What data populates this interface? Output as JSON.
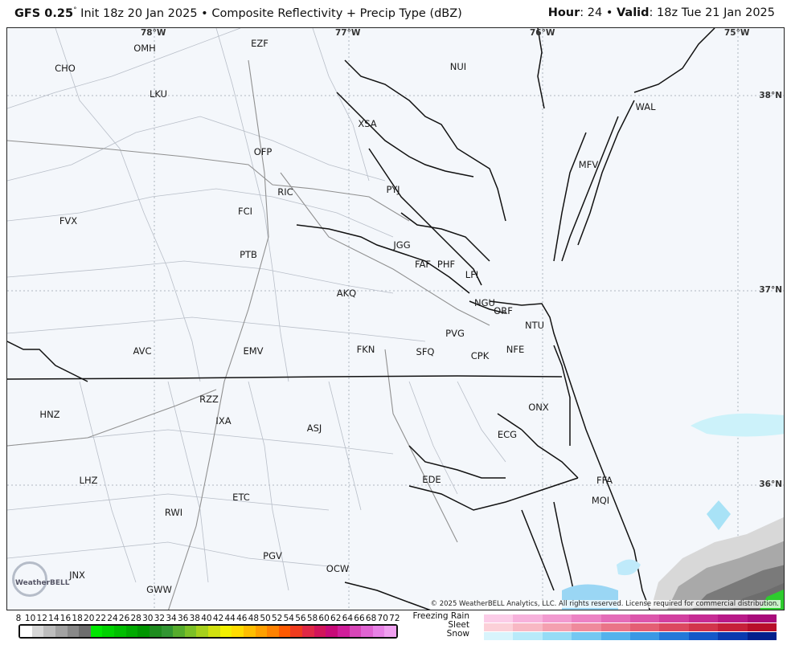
{
  "header": {
    "model": "GFS 0.25",
    "deg": "°",
    "init": " Init 18z 20 Jan 2025 • Composite Reflectivity + Precip Type (dBZ)",
    "hour_label": "Hour",
    "hour": ": 24 • ",
    "valid_label": "Valid",
    "valid": ": 18z Tue 21 Jan 2025"
  },
  "map": {
    "longitudes": [
      "78°W",
      "77°W",
      "76°W",
      "75°W"
    ],
    "latitudes": [
      "38°N",
      "37°N",
      "36°N"
    ],
    "cities": [
      "OMH",
      "EZF",
      "CHO",
      "NUI",
      "LKU",
      "XSA",
      "WAL",
      "OFP",
      "MFV",
      "RIC",
      "PYJ",
      "FCI",
      "FVX",
      "JGG",
      "PTB",
      "FAF",
      "PHF",
      "LFI",
      "AKQ",
      "NGU",
      "ORF",
      "PVG",
      "NTU",
      "AVC",
      "EMV",
      "FKN",
      "SFQ",
      "CPK",
      "NFE",
      "RZZ",
      "ONX",
      "HNZ",
      "IXA",
      "ASJ",
      "ECG",
      "EDE",
      "FFA",
      "LHZ",
      "MQI",
      "ETC",
      "RWI",
      "PGV",
      "OCW",
      "JNX",
      "GWW"
    ],
    "copyright": "© 2025 WeatherBELL Analytics, LLC. All rights reserved. License required for commercial distribution.",
    "logo": "WeatherBELL"
  },
  "legend": {
    "ticks": [
      "8",
      "10",
      "12",
      "14",
      "16",
      "18",
      "20",
      "22",
      "24",
      "26",
      "28",
      "30",
      "32",
      "34",
      "36",
      "38",
      "40",
      "42",
      "44",
      "46",
      "48",
      "50",
      "52",
      "54",
      "56",
      "58",
      "60",
      "62",
      "64",
      "66",
      "68",
      "70",
      "72"
    ],
    "colors": [
      "#ffffff",
      "#d8d8d8",
      "#bdbdbd",
      "#a2a2a2",
      "#888888",
      "#6d6d6d",
      "#00e700",
      "#00d200",
      "#00be00",
      "#00aa00",
      "#009600",
      "#1e8c1e",
      "#329632",
      "#56ac2c",
      "#7cc026",
      "#a6d01c",
      "#d0e010",
      "#f2f000",
      "#ffdc00",
      "#ffbe00",
      "#ffa000",
      "#ff8200",
      "#ff5a00",
      "#f03c1e",
      "#e02846",
      "#d2145a",
      "#c80a78",
      "#d01e9a",
      "#d846b8",
      "#e064d2",
      "#e882e6",
      "#f0a0f0"
    ],
    "freezing_rain": "Freezing Rain",
    "sleet": "Sleet",
    "snow": "Snow",
    "freezing_rain_colors": [
      "#fccde8",
      "#f7b2dc",
      "#f29ad0",
      "#ec82c4",
      "#e46cb8",
      "#dc56ac",
      "#d240a0",
      "#c62c94",
      "#b81a88",
      "#a80c7a"
    ],
    "sleet_colors": [
      "#fcd0d8",
      "#f8b8c4",
      "#f4a0b0",
      "#ef8a9c",
      "#ea7488",
      "#e45e74",
      "#dc4860",
      "#d2344c",
      "#c6203a",
      "#b80e2a"
    ],
    "snow_colors": [
      "#d8f4fc",
      "#b8eafa",
      "#96dcf6",
      "#74c8f2",
      "#54b2ec",
      "#3a98e4",
      "#2478d8",
      "#1458c8",
      "#0a3aae",
      "#04208c"
    ]
  }
}
